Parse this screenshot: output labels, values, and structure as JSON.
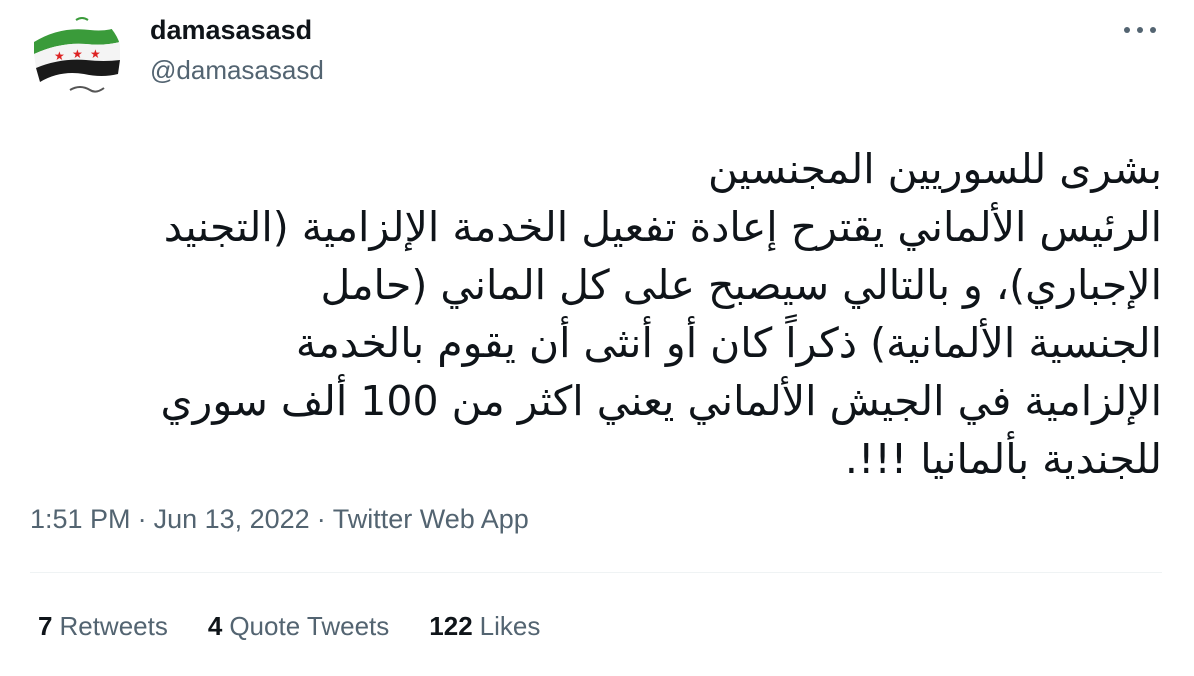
{
  "user": {
    "display_name": "damasasasd",
    "handle": "@damasasasd",
    "avatar_icon": "syrian-revolution-flag-avatar"
  },
  "menu": {
    "icon": "more-options-icon"
  },
  "tweet": {
    "lines": [
      "بشرى للسوريين المجنسين",
      "الرئيس الألماني يقترح إعادة تفعيل الخدمة الإلزامية (التجنيد",
      "الإجباري)، و بالتالي سيصبح على كل الماني (حامل",
      "الجنسية الألمانية) ذكراً كان أو أنثى أن يقوم بالخدمة",
      "الإلزامية في الجيش الألماني يعني اكثر من 100 ألف سوري",
      "للجندية بألمانيا !!!."
    ]
  },
  "meta": {
    "time": "1:51 PM",
    "date": "Jun 13, 2022",
    "source": "Twitter Web App",
    "separator": "·"
  },
  "stats": {
    "retweets": {
      "count": "7",
      "label": "Retweets"
    },
    "quote_tweets": {
      "count": "4",
      "label": "Quote Tweets"
    },
    "likes": {
      "count": "122",
      "label": "Likes"
    }
  },
  "colors": {
    "text": "#0f1419",
    "secondary": "#536471",
    "divider": "#eff3f4",
    "flag_green": "#3a9b3a",
    "flag_red": "#d22"
  }
}
